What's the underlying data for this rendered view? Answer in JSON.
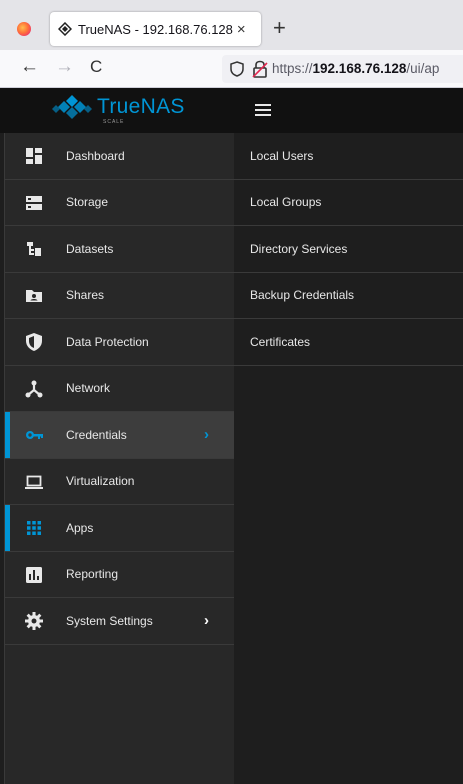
{
  "browser": {
    "tab": {
      "title": "TrueNAS - 192.168.76.128",
      "close": "×"
    },
    "new_tab": "+",
    "nav": {
      "back": "←",
      "forward": "→",
      "reload": "C"
    },
    "url": {
      "prefix": "https://",
      "host": "192.168.76.128",
      "path": "/ui/ap"
    }
  },
  "app": {
    "logo": {
      "name": "TrueNAS",
      "edition": "SCALE"
    },
    "accent_color": "#0095d5",
    "sidebar": {
      "items": [
        {
          "label": "Dashboard",
          "icon": "dashboard-icon"
        },
        {
          "label": "Storage",
          "icon": "storage-icon"
        },
        {
          "label": "Datasets",
          "icon": "datasets-icon"
        },
        {
          "label": "Shares",
          "icon": "shares-icon"
        },
        {
          "label": "Data Protection",
          "icon": "shield-icon"
        },
        {
          "label": "Network",
          "icon": "network-icon"
        },
        {
          "label": "Credentials",
          "icon": "key-icon",
          "active": true,
          "chevron": "›"
        },
        {
          "label": "Virtualization",
          "icon": "laptop-icon"
        },
        {
          "label": "Apps",
          "icon": "apps-grid-icon"
        },
        {
          "label": "Reporting",
          "icon": "reporting-icon"
        },
        {
          "label": "System Settings",
          "icon": "gear-icon",
          "chevron": "›"
        }
      ]
    },
    "submenu": {
      "items": [
        {
          "label": "Local Users"
        },
        {
          "label": "Local Groups"
        },
        {
          "label": "Directory Services"
        },
        {
          "label": "Backup Credentials"
        },
        {
          "label": "Certificates"
        }
      ]
    }
  }
}
